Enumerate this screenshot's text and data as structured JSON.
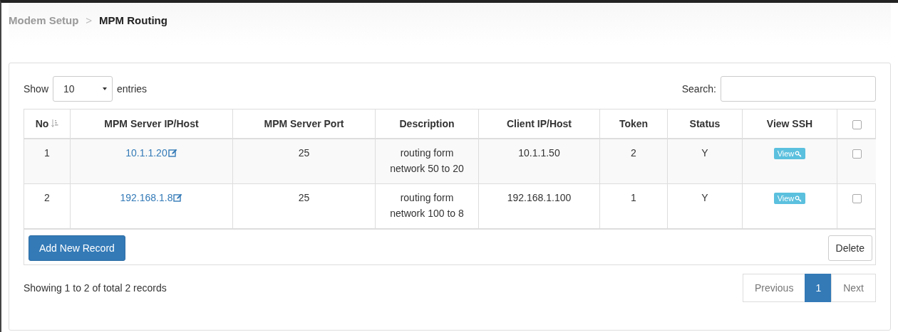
{
  "breadcrumb": [
    {
      "label": "Modem Setup",
      "current": false
    },
    {
      "label": "MPM Routing",
      "current": true
    }
  ],
  "breadcrumb_separator": ">",
  "length_menu": {
    "prefix": "Show",
    "value": "10",
    "suffix": "entries"
  },
  "search": {
    "label": "Search:"
  },
  "table": {
    "columns": [
      "No",
      "MPM Server IP/Host",
      "MPM Server Port",
      "Description",
      "Client IP/Host",
      "Token",
      "Status",
      "View SSH"
    ],
    "select_all_checked": false,
    "rows": [
      {
        "no": "1",
        "server": "10.1.1.20",
        "port": "25",
        "description": "routing form network 50 to 20",
        "client": "10.1.1.50",
        "token": "2",
        "status": "Y",
        "view": "View",
        "checked": false
      },
      {
        "no": "2",
        "server": "192.168.1.8",
        "port": "25",
        "description": "routing form network 100 to 8",
        "client": "192.168.1.100",
        "token": "1",
        "status": "Y",
        "view": "View",
        "checked": false
      }
    ]
  },
  "add_button": "Add New Record",
  "delete_button": "Delete",
  "info": "Showing 1 to 2 of total 2 records",
  "pagination": [
    {
      "label": "Previous",
      "kind": "nav",
      "selected": false
    },
    {
      "label": "1",
      "kind": "page",
      "selected": true
    },
    {
      "label": "Next",
      "kind": "nav",
      "selected": false
    }
  ]
}
